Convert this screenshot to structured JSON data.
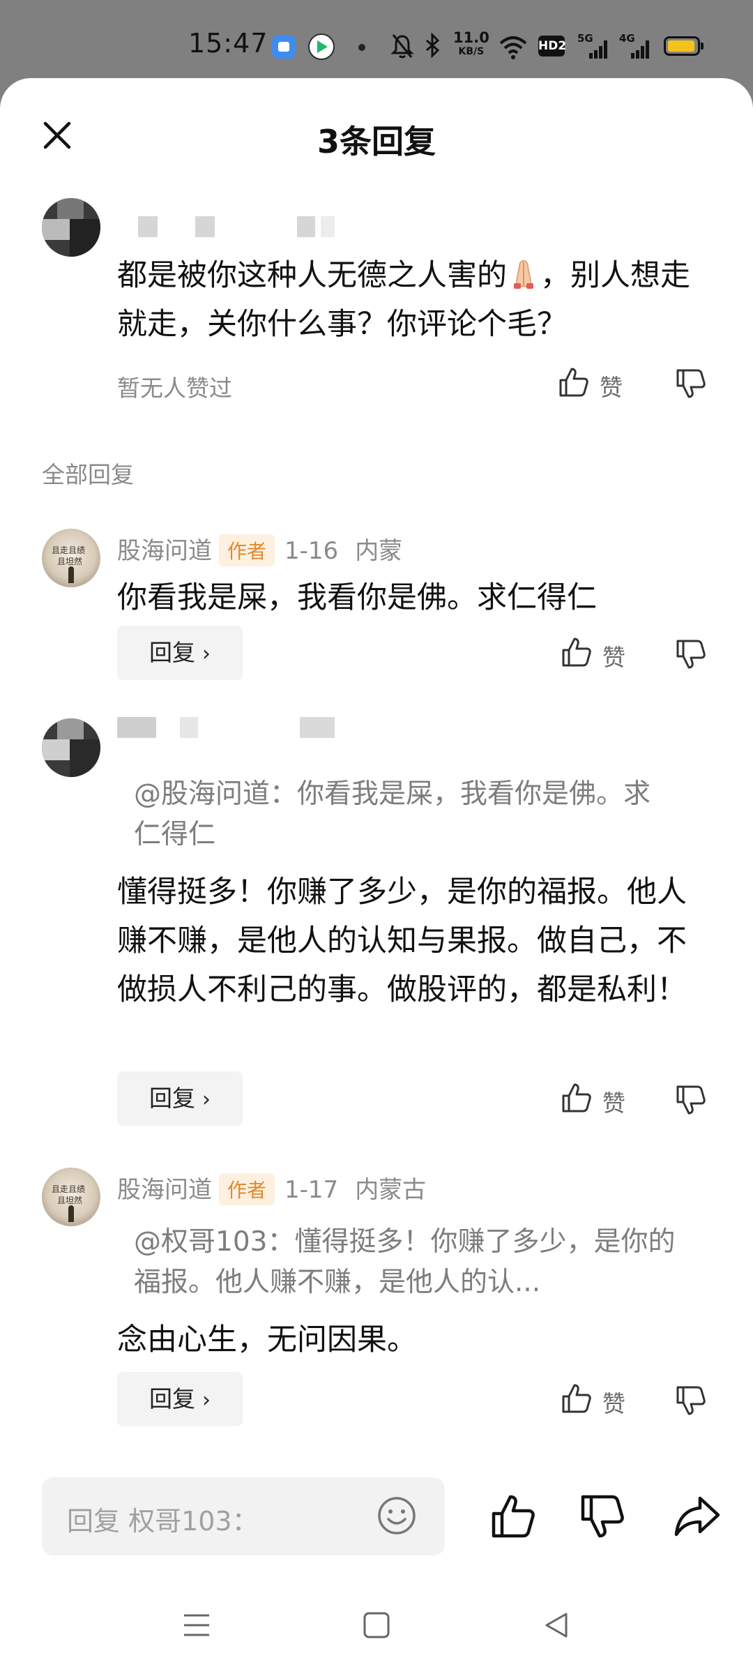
{
  "status_bar": {
    "time": "15:47",
    "net_speed_value": "11.0",
    "net_speed_unit": "KB/S",
    "hd_badge": "HD2",
    "sim1_label": "5G",
    "sim2_label": "4G",
    "battery_color": "#f5c21b",
    "icons": [
      "app-icon-blue",
      "video-app-icon",
      "dot",
      "mute-icon",
      "bluetooth-icon",
      "wifi-icon",
      "signal-icon",
      "battery-icon"
    ]
  },
  "sheet": {
    "title": "3条回复"
  },
  "root_comment": {
    "text_part1": "都是被你这种人无德之人害的",
    "text_part2": "，别人想走就走，关你什么事？你评论个毛？",
    "likes_status": "暂无人赞过",
    "like_label": "赞"
  },
  "section_label": "全部回复",
  "replies": [
    {
      "author": "股海问道",
      "badge": "作者",
      "date": "1-16",
      "location": "内蒙",
      "text": "你看我是屎，我看你是佛。求仁得仁",
      "reply_label": "回复",
      "like_label": "赞"
    },
    {
      "author": "",
      "quote": "@股海问道：你看我是屎，我看你是佛。求仁得仁",
      "text": "懂得挺多！你赚了多少，是你的福报。他人赚不赚，是他人的认知与果报。做自己，不做损人不利己的事。做股评的，都是私利！",
      "reply_label": "回复",
      "like_label": "赞"
    },
    {
      "author": "股海问道",
      "badge": "作者",
      "date": "1-17",
      "location": "内蒙古",
      "quote": "@权哥103：懂得挺多！你赚了多少，是你的福报。他人赚不赚，是他人的认...",
      "text": "念由心生，无问因果。",
      "reply_label": "回复",
      "like_label": "赞"
    }
  ],
  "composer": {
    "placeholder": "回复 权哥103："
  },
  "colors": {
    "badge_bg": "#fdf0e0",
    "badge_text": "#e08a2e",
    "muted_text": "#8a8a8a"
  }
}
